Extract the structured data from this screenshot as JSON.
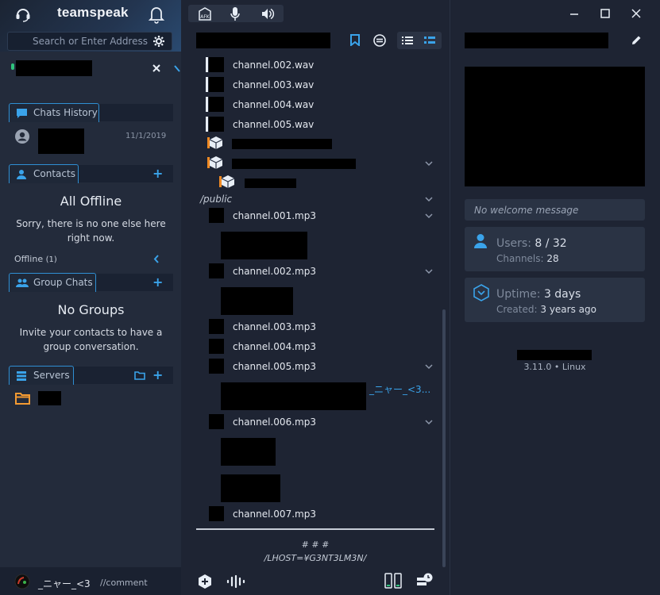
{
  "app": {
    "brand": "teamspeak"
  },
  "search": {
    "placeholder": "Search or Enter Address"
  },
  "chats_history": {
    "tab_label": "Chats History",
    "entry_date": "11/1/2019"
  },
  "contacts": {
    "tab_label": "Contacts",
    "empty_title": "All Offline",
    "empty_text": "Sorry, there is no one else here right now.",
    "offline_label": "Offline",
    "offline_count": "(1)"
  },
  "group_chats": {
    "tab_label": "Group Chats",
    "empty_title": "No Groups",
    "empty_text": "Invite your contacts to have a group conversation."
  },
  "servers": {
    "tab_label": "Servers"
  },
  "user_bar": {
    "nickname": "_ニャー_<3",
    "status": "//comment"
  },
  "toolbar": {
    "afk": "AFK"
  },
  "channels": {
    "items": [
      {
        "label": "channel.002.wav"
      },
      {
        "label": "channel.003.wav"
      },
      {
        "label": "channel.004.wav"
      },
      {
        "label": "channel.005.wav"
      }
    ],
    "public_label": "/public",
    "mp3": [
      {
        "label": "channel.001.mp3"
      },
      {
        "label": "channel.002.mp3"
      },
      {
        "label": "channel.003.mp3"
      },
      {
        "label": "channel.004.mp3"
      },
      {
        "label": "channel.005.mp3"
      },
      {
        "label": "channel.006.mp3"
      },
      {
        "label": "channel.007.mp3"
      }
    ],
    "client_name": "_ニャー_<3..."
  },
  "mid_footer": {
    "line1": "# # #",
    "line2": "/LHOST=¥G3NT3LM3N/"
  },
  "server_info": {
    "welcome": "No welcome message",
    "users_label": "Users:",
    "users_value": "8 / 32",
    "channels_label": "Channels:",
    "channels_value": "28",
    "uptime_label": "Uptime:",
    "uptime_value": "3 days",
    "created_label": "Created:",
    "created_value": "3 years ago",
    "version": "3.11.0 • Linux"
  },
  "colors": {
    "accent": "#3aa3ea",
    "bg": "#1e2433",
    "panel": "#232b3b",
    "card": "#2a3344"
  }
}
